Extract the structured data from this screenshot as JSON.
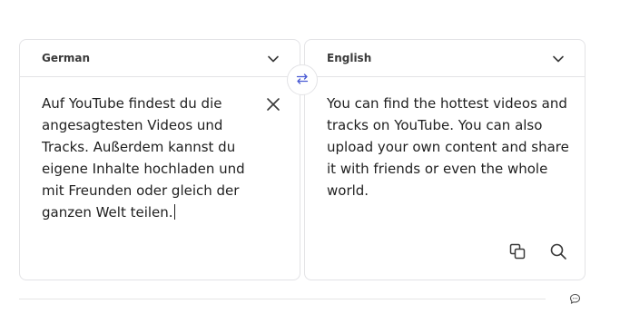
{
  "source": {
    "language": "German",
    "text": "Auf YouTube findest du die angesagtesten Videos und Tracks. Außerdem kannst du eigene Inhalte hochladen und mit Freunden oder gleich der ganzen Welt teilen."
  },
  "target": {
    "language": "English",
    "text": "You can find the hottest videos and tracks on YouTube. You can also upload your own content and share it with friends or even the whole world."
  },
  "icons": {
    "source_dropdown": "chevron-down-icon",
    "target_dropdown": "chevron-down-icon",
    "clear": "close-icon",
    "swap": "swap-arrows-icon",
    "copy": "copy-icon",
    "search": "search-icon",
    "feedback": "chat-bubble-icon"
  },
  "colors": {
    "accent": "#4a5bd4",
    "border": "#e3e3e6",
    "text": "#1f1f1f",
    "icon": "#3a3a3a"
  }
}
